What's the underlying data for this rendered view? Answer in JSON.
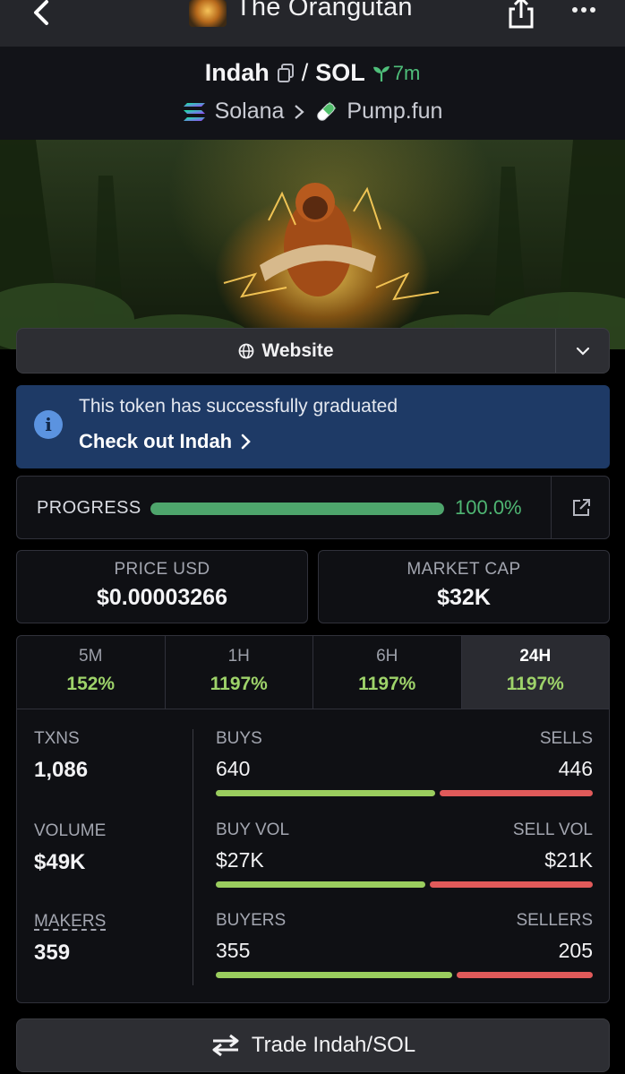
{
  "header": {
    "title": "The Orangutan",
    "back_icon": "chevron-left-icon",
    "share_icon": "share-icon",
    "more_icon": "more-horizontal-icon"
  },
  "pair": {
    "base": "Indah",
    "separator": "/",
    "quote": "SOL",
    "age": "7m",
    "chain": "Solana",
    "dex": "Pump.fun"
  },
  "website": {
    "label": "Website"
  },
  "notice": {
    "text": "This token has successfully graduated",
    "link": "Check out Indah"
  },
  "progress": {
    "label": "PROGRESS",
    "value_text": "100.0%",
    "fraction": 1.0
  },
  "price_usd": {
    "label": "PRICE USD",
    "value": "$0.00003266"
  },
  "market_cap": {
    "label": "MARKET CAP",
    "value": "$32K"
  },
  "timeframes": [
    {
      "label": "5M",
      "value": "152%",
      "active": false
    },
    {
      "label": "1H",
      "value": "1197%",
      "active": false
    },
    {
      "label": "6H",
      "value": "1197%",
      "active": false
    },
    {
      "label": "24H",
      "value": "1197%",
      "active": true
    }
  ],
  "stats": {
    "txns": {
      "label": "TXNS",
      "value": "1,086"
    },
    "volume": {
      "label": "VOLUME",
      "value": "$49K"
    },
    "makers": {
      "label": "MAKERS",
      "value": "359"
    },
    "buys": {
      "label": "BUYS",
      "value": "640",
      "share": 0.589
    },
    "sells": {
      "label": "SELLS",
      "value": "446"
    },
    "buy_vol": {
      "label": "BUY VOL",
      "value": "$27K",
      "share": 0.563
    },
    "sell_vol": {
      "label": "SELL VOL",
      "value": "$21K"
    },
    "buyers": {
      "label": "BUYERS",
      "value": "355",
      "share": 0.634
    },
    "sellers": {
      "label": "SELLERS",
      "value": "205"
    }
  },
  "trade": {
    "label": "Trade Indah/SOL"
  },
  "colors": {
    "green": "#4fb673",
    "lime": "#9acd5e",
    "red": "#e05a5a",
    "notice_bg": "#1e3a66"
  }
}
